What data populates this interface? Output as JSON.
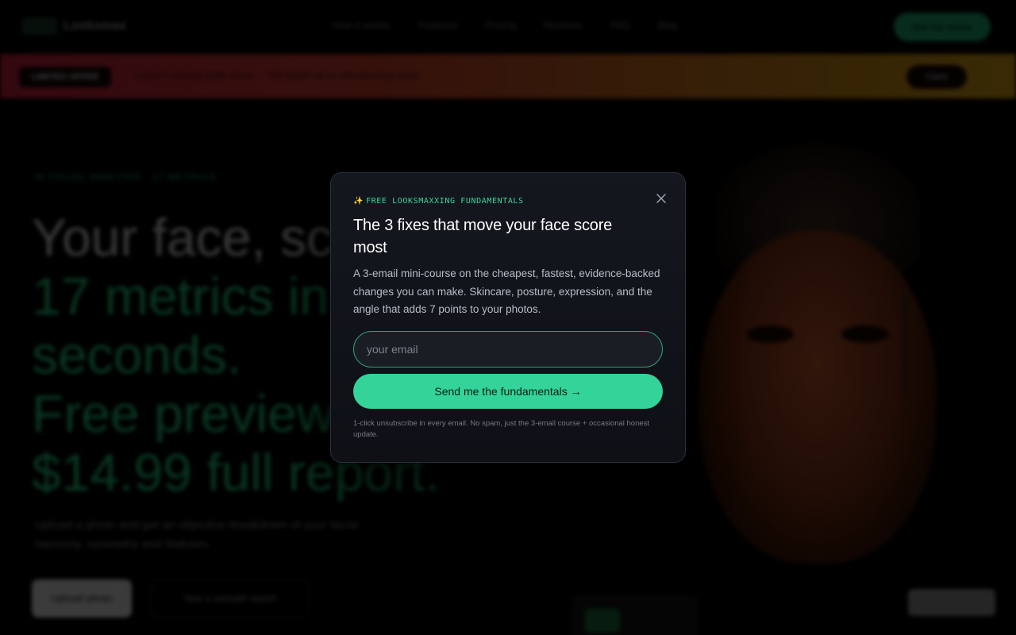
{
  "background": {
    "nav": {
      "logo_text": "Looksmax",
      "links": [
        "How it works",
        "Features",
        "Pricing",
        "Reviews",
        "FAQ",
        "Blog"
      ],
      "cta_label": "Get my score"
    },
    "promo": {
      "tag": "LIMITED OFFER",
      "text": "Launch pricing ends soon — full report at an introductory price",
      "button": "Claim"
    },
    "hero": {
      "eyebrow": "AI FACIAL ANALYSIS · 17 METRICS",
      "lines": [
        "Your face, scored.",
        "17 metrics in",
        "seconds.",
        "Free preview.",
        "$14.99 full report."
      ],
      "subtitle": "Upload a photo and get an objective breakdown of your facial harmony, symmetry and features.",
      "primary_button": "Upload photo",
      "secondary_button": "See a sample report"
    }
  },
  "modal": {
    "eyebrow_icon": "✨",
    "eyebrow": "FREE LOOKSMAXXING FUNDAMENTALS",
    "close_icon": "close-icon",
    "title": "The 3 fixes that move your face score most",
    "description": "A 3-email mini-course on the cheapest, fastest, evidence-backed changes you can make. Skincare, posture, expression, and the angle that adds 7 points to your photos.",
    "email_placeholder": "your email",
    "email_value": "",
    "submit_label": "Send me the fundamentals →",
    "fine_print": "1-click unsubscribe in every email. No spam, just the 3-email course + occasional honest update."
  },
  "colors": {
    "accent": "#34d399",
    "eyebrow": "#3ad49a",
    "modal_bg": "#13151c",
    "modal_border": "#2b2f3a"
  }
}
